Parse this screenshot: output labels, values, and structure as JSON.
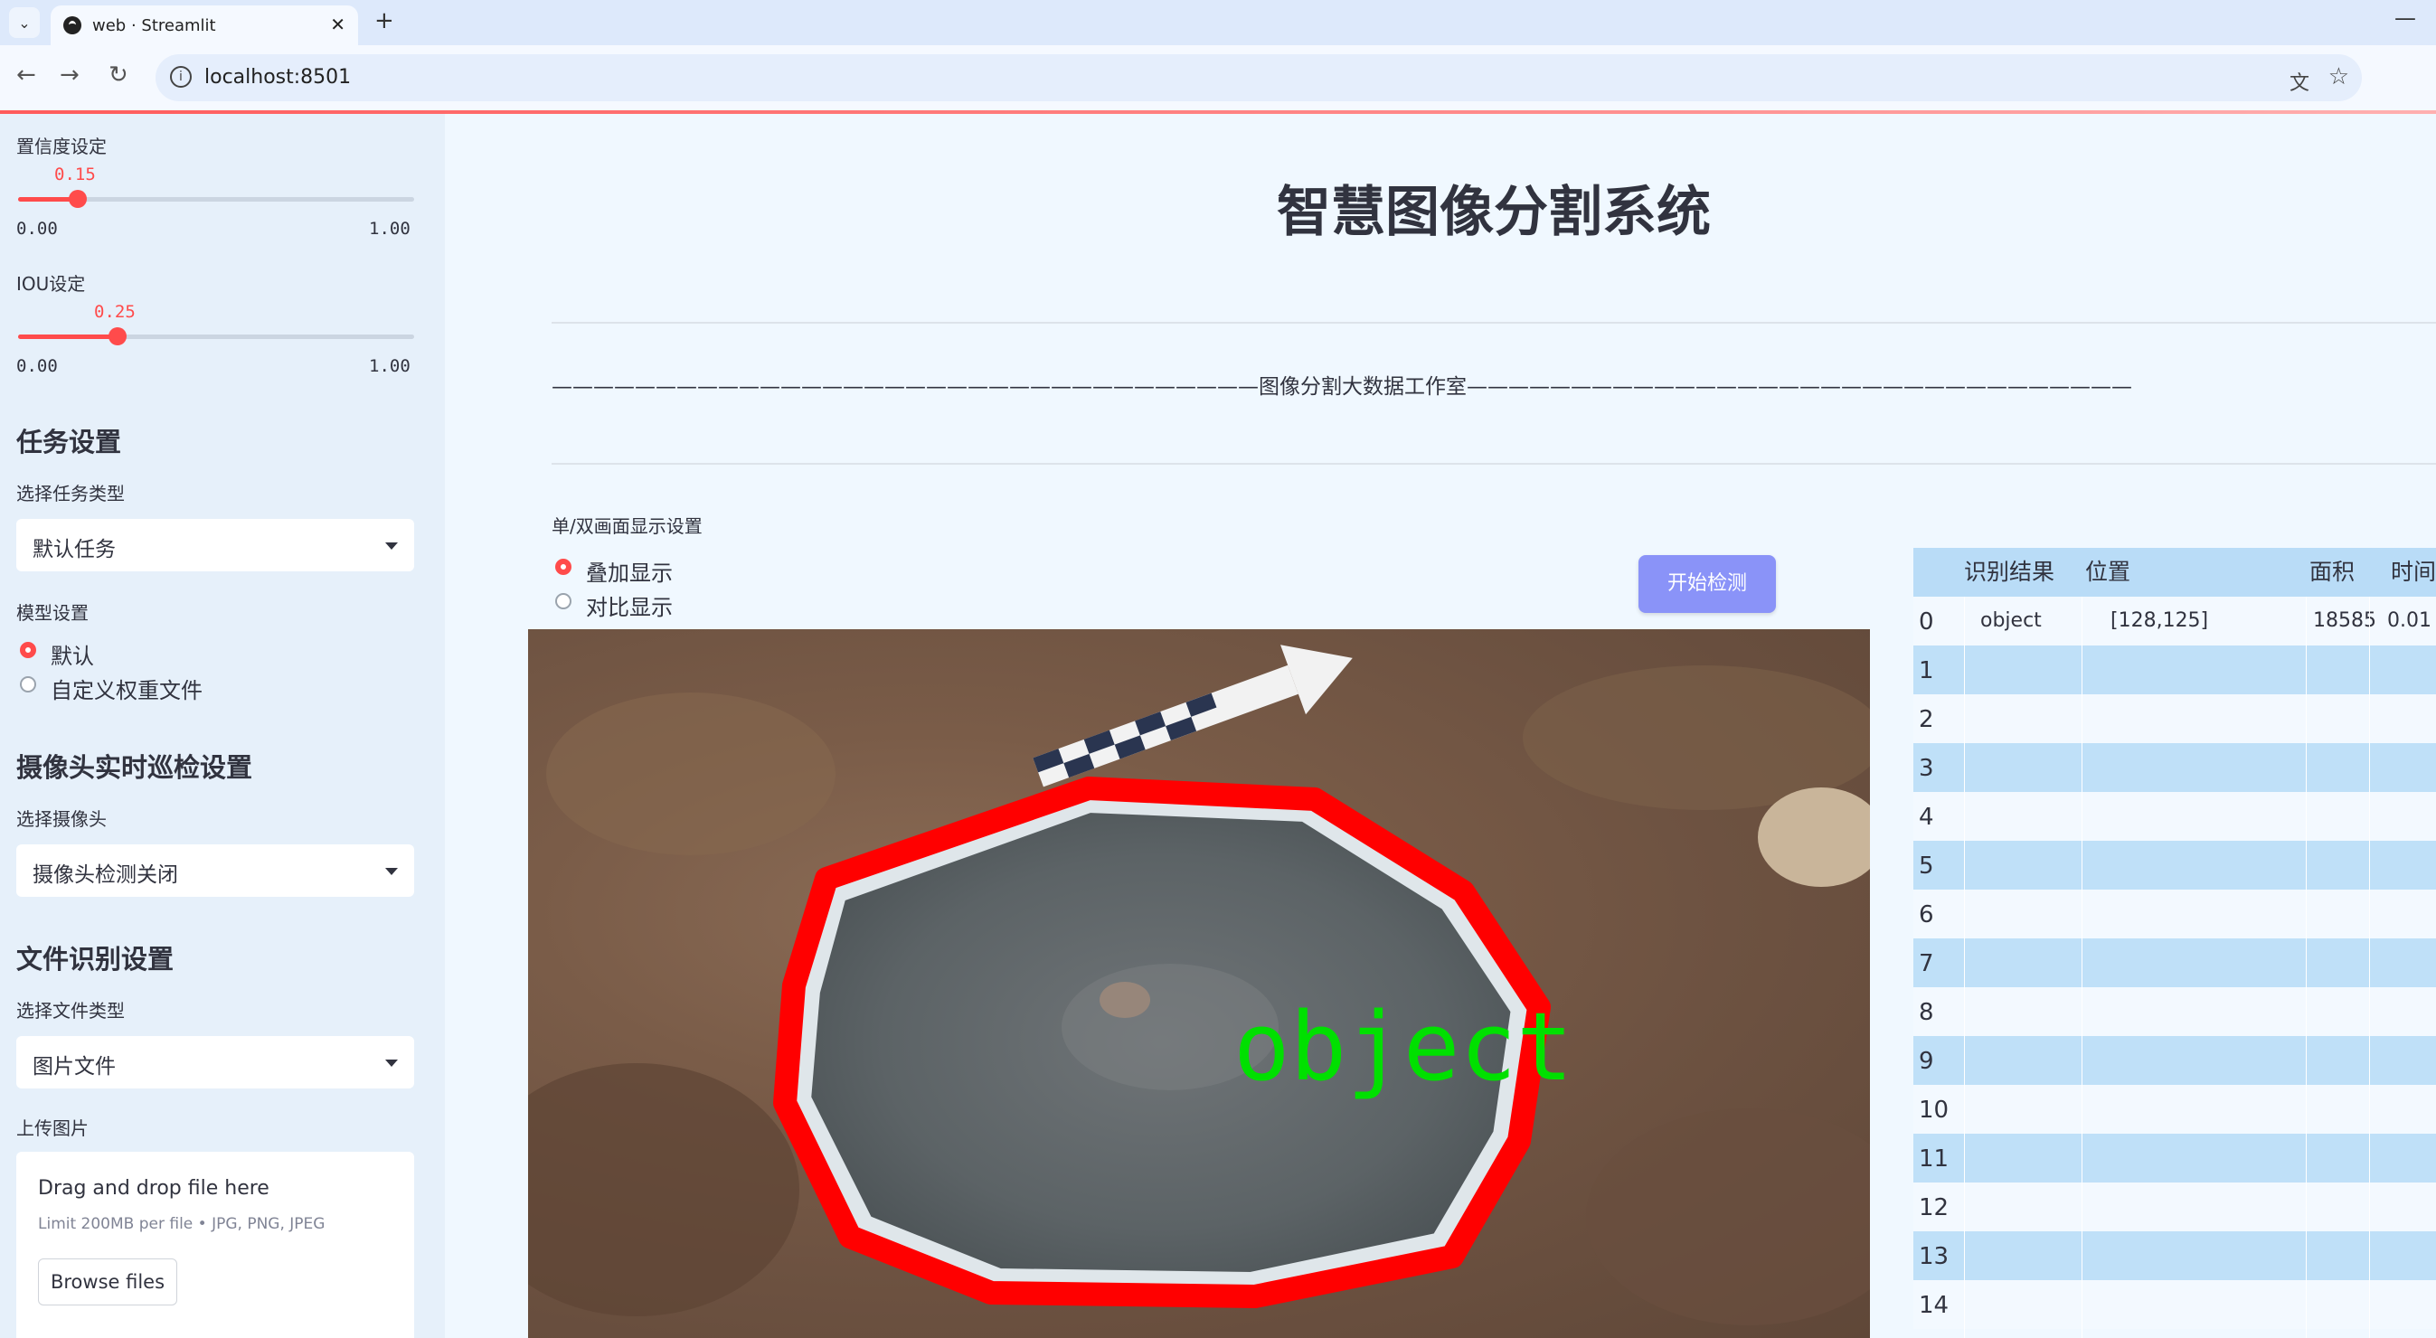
{
  "browser": {
    "tab_title": "web · Streamlit",
    "url": "localhost:8501"
  },
  "sidebar": {
    "conf": {
      "label": "置信度设定",
      "value": "0.15",
      "min": "0.00",
      "max": "1.00",
      "fraction": 0.15
    },
    "iou": {
      "label": "IOU设定",
      "value": "0.25",
      "min": "0.00",
      "max": "1.00",
      "fraction": 0.25
    },
    "task_heading": "任务设置",
    "task_type_label": "选择任务类型",
    "task_type_value": "默认任务",
    "model_label": "模型设置",
    "model_options": [
      "默认",
      "自定义权重文件"
    ],
    "model_selected": 0,
    "camera_heading": "摄像头实时巡检设置",
    "camera_label": "选择摄像头",
    "camera_value": "摄像头检测关闭",
    "file_heading": "文件识别设置",
    "file_type_label": "选择文件类型",
    "file_type_value": "图片文件",
    "upload_label": "上传图片",
    "uploader": {
      "title": "Drag and drop file here",
      "limit": "Limit 200MB per file • JPG, PNG, JPEG",
      "button": "Browse files"
    }
  },
  "main": {
    "title": "智慧图像分割系统",
    "divider_text": "——————————————————————————————————图像分割大数据工作室————————————————————————————————",
    "display_mode_label": "单/双画面显示设置",
    "display_options": [
      "叠加显示",
      "对比显示"
    ],
    "display_selected": 0,
    "start_button": "开始检测",
    "image_label": "object"
  },
  "table": {
    "columns": [
      "识别结果",
      "位置",
      "面积",
      "时间"
    ],
    "rows": [
      {
        "index": "0",
        "result": "object",
        "position": "[128,125]",
        "area": "18585",
        "time": "0.01"
      },
      {
        "index": "1"
      },
      {
        "index": "2"
      },
      {
        "index": "3"
      },
      {
        "index": "4"
      },
      {
        "index": "5"
      },
      {
        "index": "6"
      },
      {
        "index": "7"
      },
      {
        "index": "8"
      },
      {
        "index": "9"
      },
      {
        "index": "10"
      },
      {
        "index": "11"
      },
      {
        "index": "12"
      },
      {
        "index": "13"
      },
      {
        "index": "14"
      }
    ]
  },
  "colors": {
    "accent": "#ff4b4b",
    "button": "#8a93f8",
    "table_header": "#b9dcf7",
    "mask_outline": "#ff0000",
    "label_text": "#00e000"
  }
}
